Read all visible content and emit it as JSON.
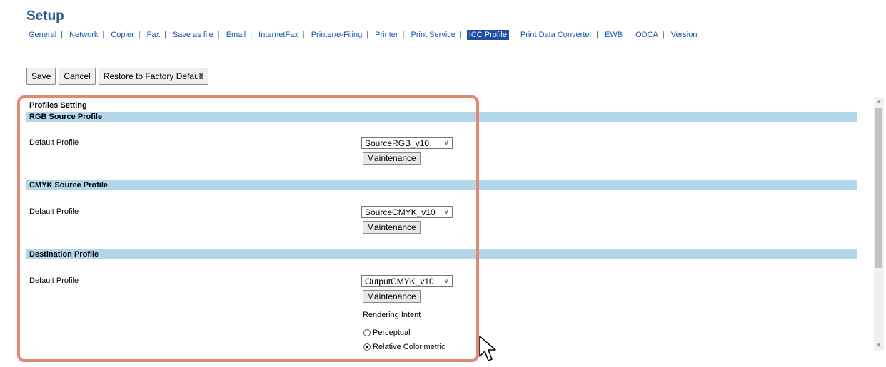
{
  "header": {
    "title": "Setup"
  },
  "nav": {
    "items": [
      "General",
      "Network",
      "Copier",
      "Fax",
      "Save as file",
      "Email",
      "InternetFax",
      "Printer/e-Filing",
      "Printer",
      "Print Service",
      "ICC Profile",
      "Print Data Converter",
      "EWB",
      "ODCA",
      "Version"
    ],
    "active": "ICC Profile"
  },
  "toolbar": {
    "save_label": "Save",
    "cancel_label": "Cancel",
    "restore_label": "Restore to Factory Default"
  },
  "profiles": {
    "title": "Profiles Setting",
    "rgb": {
      "header": "RGB Source Profile",
      "default_label": "Default Profile",
      "selected": "SourceRGB_v10",
      "maintenance_label": "Maintenance"
    },
    "cmyk": {
      "header": "CMYK Source Profile",
      "default_label": "Default Profile",
      "selected": "SourceCMYK_v10",
      "maintenance_label": "Maintenance"
    },
    "destination": {
      "header": "Destination Profile",
      "default_label": "Default Profile",
      "selected": "OutputCMYK_v10",
      "maintenance_label": "Maintenance",
      "rendering_intent_label": "Rendering Intent",
      "options": [
        {
          "label": "Perceptual",
          "checked": false
        },
        {
          "label": "Relative Colorimetric",
          "checked": true
        }
      ]
    }
  },
  "colors": {
    "section_header_bg": "#b4d6ea",
    "highlight": "#e18a73",
    "link": "#1a55b3",
    "active_tab": "#1f4ea8",
    "title": "#2a5d8f"
  },
  "icons": {
    "select": "chevron-down-icon",
    "scroll_up": "chevron-up-icon",
    "scroll_down": "chevron-down-icon",
    "cursor": "mouse-pointer-icon"
  }
}
